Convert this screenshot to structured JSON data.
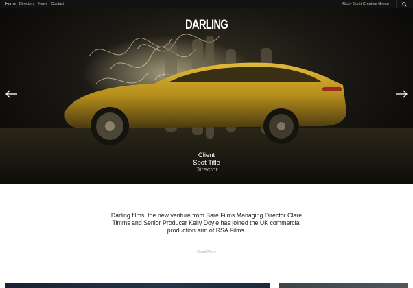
{
  "nav": {
    "items": [
      {
        "label": "Home",
        "active": true
      },
      {
        "label": "Directors",
        "active": false
      },
      {
        "label": "News",
        "active": false
      },
      {
        "label": "Contact",
        "active": false
      }
    ],
    "group_label": "Ricky Scott Creative Group",
    "search_icon": "search-icon"
  },
  "hero": {
    "logo_text": "DARLING",
    "client": "Client",
    "spot_title": "Spot Title",
    "director": "Director",
    "prev_icon": "arrow-left-icon",
    "next_icon": "arrow-right-icon"
  },
  "intro": {
    "text": "Darling films, the new venture from Bare Films Managing Director Clare Timms and Senior Producer Kelly Doyle has joined the UK commercial production arm of RSA Films.",
    "read_more": "Read More"
  },
  "colors": {
    "topbar": "#111111",
    "car": "#c9a227",
    "background": "#ffffff"
  }
}
